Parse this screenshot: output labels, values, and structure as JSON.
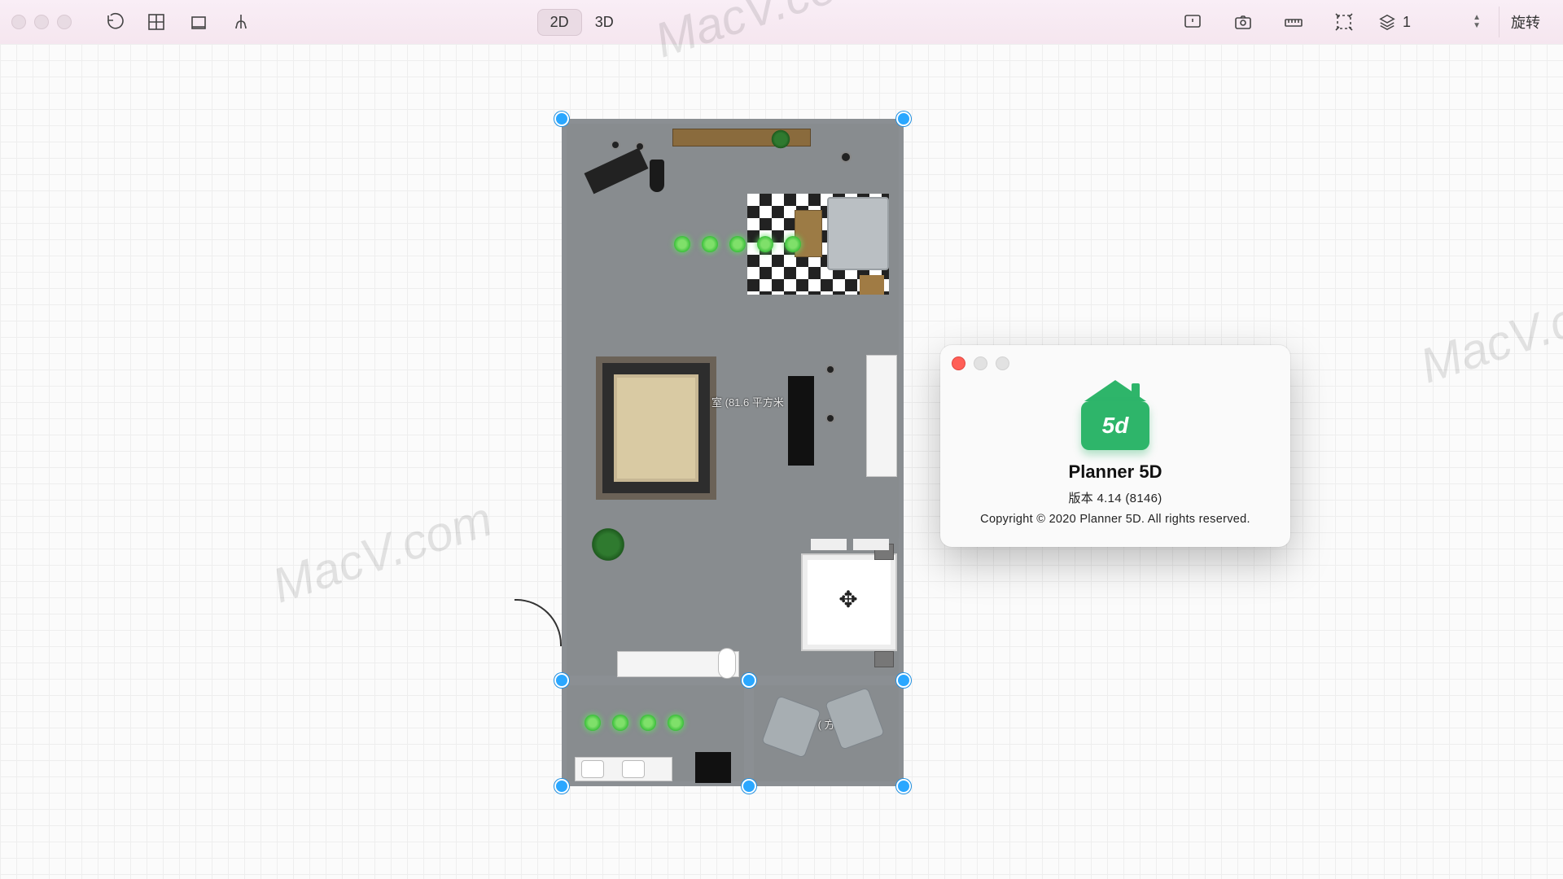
{
  "toolbar": {
    "view_modes": {
      "two_d": "2D",
      "three_d": "3D",
      "active": "2D"
    },
    "floor_label": "1",
    "rotate_label": "旋转"
  },
  "about": {
    "logo_text": "5d",
    "title": "Planner 5D",
    "version_line": "版本 4.14 (8146)",
    "copyright": "Copyright © 2020 Planner 5D. All rights reserved."
  },
  "room_labels": {
    "living": "室 (81.6 平方米",
    "balcony": "台 (    方"
  },
  "watermark": "MacV.com",
  "icons": {
    "history": "history-icon",
    "rooms": "rooms-icon",
    "construction": "construction-icon",
    "exterior": "exterior-icon",
    "feedback": "feedback-icon",
    "snapshot": "snapshot-icon",
    "ruler": "ruler-icon",
    "extents": "extents-icon",
    "layers": "layers-icon"
  }
}
